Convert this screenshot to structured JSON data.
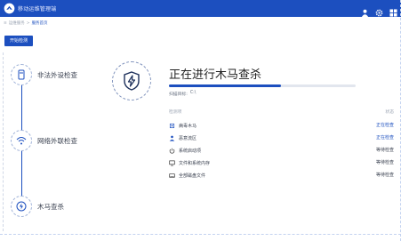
{
  "app": {
    "title": "移动运维管理端"
  },
  "topbar": {
    "icons": [
      "user-icon",
      "gear-icon",
      "grid-icon"
    ]
  },
  "breadcrumb": {
    "separator": "≡",
    "parent": "运维服务",
    "divider": ">",
    "current": "服务首页"
  },
  "toolbar": {
    "start_label": "开始检测"
  },
  "steps": [
    {
      "label": "非法外设检查",
      "icon": "usb-icon"
    },
    {
      "label": "网络外联检查",
      "icon": "wifi-icon"
    },
    {
      "label": "木马查杀",
      "icon": "lightning-shield-icon"
    }
  ],
  "scan": {
    "title": "正在进行木马查杀",
    "progress": 0.6,
    "target_label": "扫描目标:",
    "target_value": "C:\\",
    "column_item": "检测项",
    "column_status": "状态",
    "items": [
      {
        "name": "病毒木马",
        "status": "正在检查",
        "state": "active",
        "icon": "bug-icon"
      },
      {
        "name": "恶意流区",
        "status": "正在检查",
        "state": "active",
        "icon": "users-icon"
      },
      {
        "name": "系统启动项",
        "status": "等待检查",
        "state": "wait",
        "icon": "power-icon"
      },
      {
        "name": "文件和系统内存",
        "status": "等待检查",
        "state": "wait",
        "icon": "monitor-icon"
      },
      {
        "name": "全部磁盘文件",
        "status": "等待检查",
        "state": "wait",
        "icon": "disk-icon"
      }
    ]
  },
  "colors": {
    "primary": "#1c4fbf",
    "text": "#3a4150",
    "muted": "#9aa3b2"
  }
}
